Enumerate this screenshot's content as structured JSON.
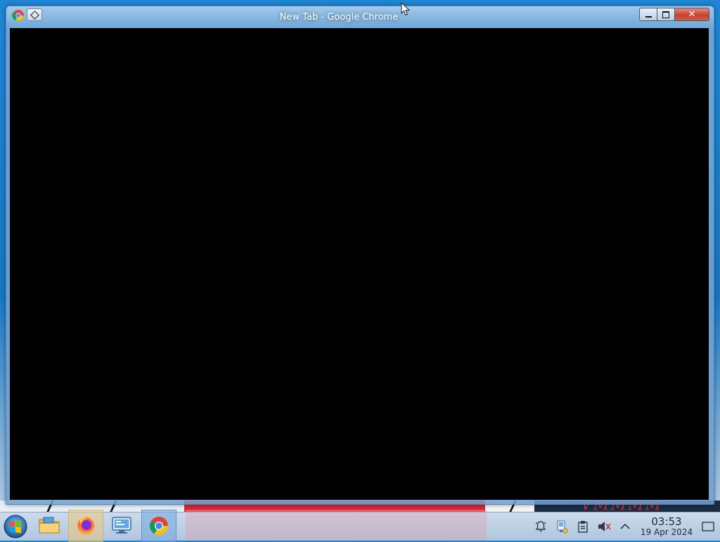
{
  "window": {
    "title": "New Tab - Google Chrome",
    "close_symbol": "✕"
  },
  "desktop": {
    "wallpaper_text": "VMMMM"
  },
  "taskbar": {
    "pinned": [
      {
        "name": "file-explorer",
        "icon": "folder-icon"
      },
      {
        "name": "firefox",
        "icon": "firefox-icon"
      },
      {
        "name": "control-panel",
        "icon": "computer-settings-icon"
      },
      {
        "name": "chrome",
        "icon": "chrome-icon"
      }
    ],
    "clock": {
      "time": "03:53",
      "date": "19 Apr 2024"
    }
  },
  "colors": {
    "desktop_blue": "#1877c4",
    "content_black": "#000000",
    "close_red": "#c7432f",
    "wallpaper_red": "#d8262e"
  }
}
